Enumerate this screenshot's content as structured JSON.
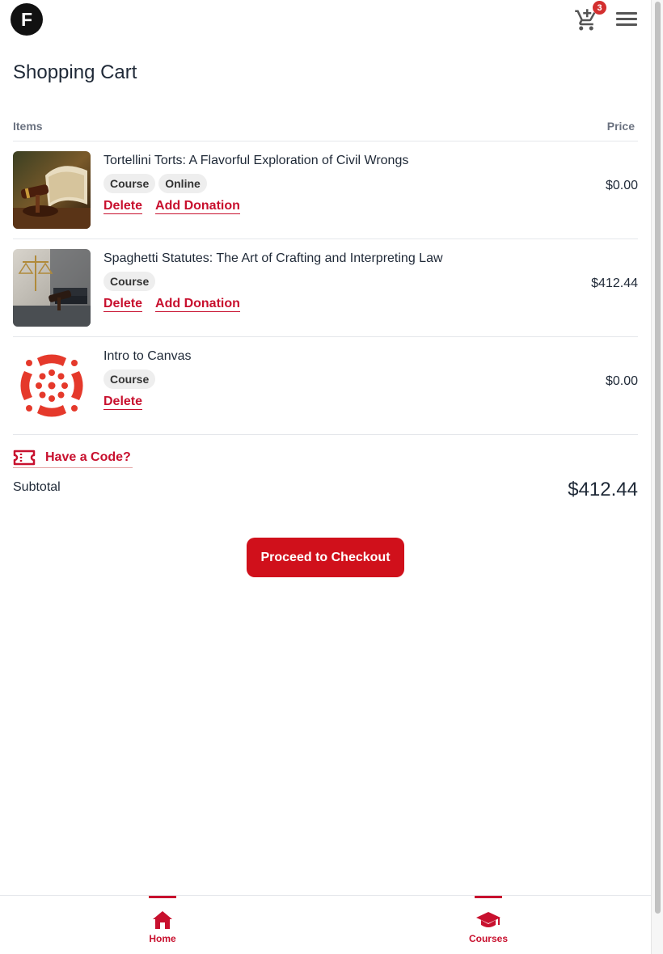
{
  "header": {
    "logo_letter": "F",
    "cart_count": "3",
    "menu_icon": "hamburger-menu-icon",
    "cart_icon": "shopping-cart-icon"
  },
  "page": {
    "title": "Shopping Cart"
  },
  "table": {
    "items_header": "Items",
    "price_header": "Price"
  },
  "cart_items": [
    {
      "title": "Tortellini Torts: A Flavorful Exploration of Civil Wrongs",
      "tags": [
        "Course",
        "Online"
      ],
      "delete_label": "Delete",
      "donation_label": "Add Donation",
      "price": "$0.00",
      "image_icon": "gavel-and-book-image"
    },
    {
      "title": "Spaghetti Statutes: The Art of Crafting and Interpreting Law",
      "tags": [
        "Course"
      ],
      "delete_label": "Delete",
      "donation_label": "Add Donation",
      "price": "$412.44",
      "image_icon": "scales-of-justice-image"
    },
    {
      "title": "Intro to Canvas",
      "tags": [
        "Course"
      ],
      "delete_label": "Delete",
      "price": "$0.00",
      "image_icon": "canvas-logo"
    }
  ],
  "code": {
    "label": "Have a Code?",
    "icon": "ticket-icon"
  },
  "subtotal": {
    "label": "Subtotal",
    "value": "$412.44"
  },
  "checkout": {
    "label": "Proceed to Checkout"
  },
  "nav": {
    "home_label": "Home",
    "courses_label": "Courses"
  },
  "colors": {
    "accent": "#c8102e",
    "button": "#d0101b",
    "badge": "#d32f2f"
  }
}
